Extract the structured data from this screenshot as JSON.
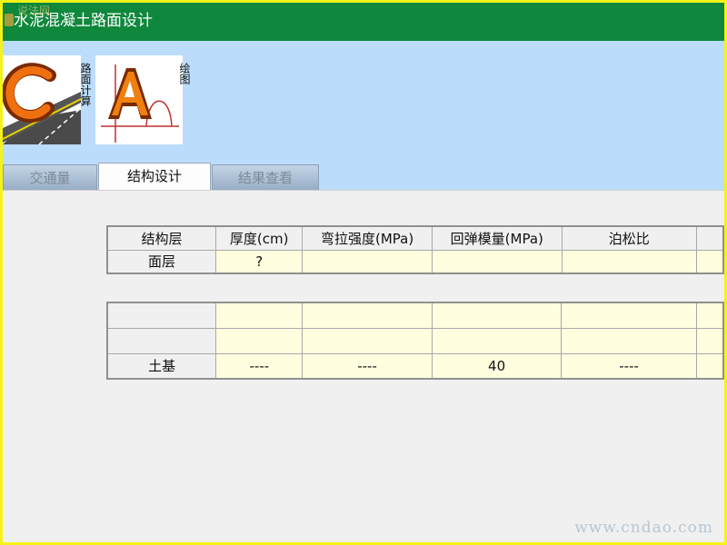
{
  "window": {
    "title": "水泥混凝土路面设计",
    "corner_watermark": "说法网"
  },
  "ribbon": {
    "buttons": [
      {
        "id": "calc",
        "label": "路面计算",
        "icon": "road-calc-logo-icon"
      },
      {
        "id": "draw",
        "label": "绘图",
        "icon": "autocad-drawing-logo-icon"
      }
    ]
  },
  "tabs": [
    {
      "label": "交通量",
      "active": false
    },
    {
      "label": "结构设计",
      "active": true
    },
    {
      "label": "结果查看",
      "active": false
    }
  ],
  "table_top": {
    "headers": [
      "结构层",
      "厚度(cm)",
      "弯拉强度(MPa)",
      "回弹模量(MPa)",
      "泊松比",
      ""
    ],
    "rows": [
      [
        "面层",
        "?",
        "",
        "",
        "",
        ""
      ]
    ]
  },
  "table_bottom": {
    "rows": [
      [
        "",
        "",
        "",
        "",
        "",
        ""
      ],
      [
        "",
        "",
        "",
        "",
        "",
        ""
      ],
      [
        "土基",
        "----",
        "----",
        "40",
        "----",
        ""
      ]
    ]
  },
  "watermark": "www.cndao.com",
  "colors": {
    "titlebar": "#0f873c",
    "ribbon": "#bcdcfb",
    "input_cell": "#ffffe0",
    "frame_border": "#f5f219"
  }
}
